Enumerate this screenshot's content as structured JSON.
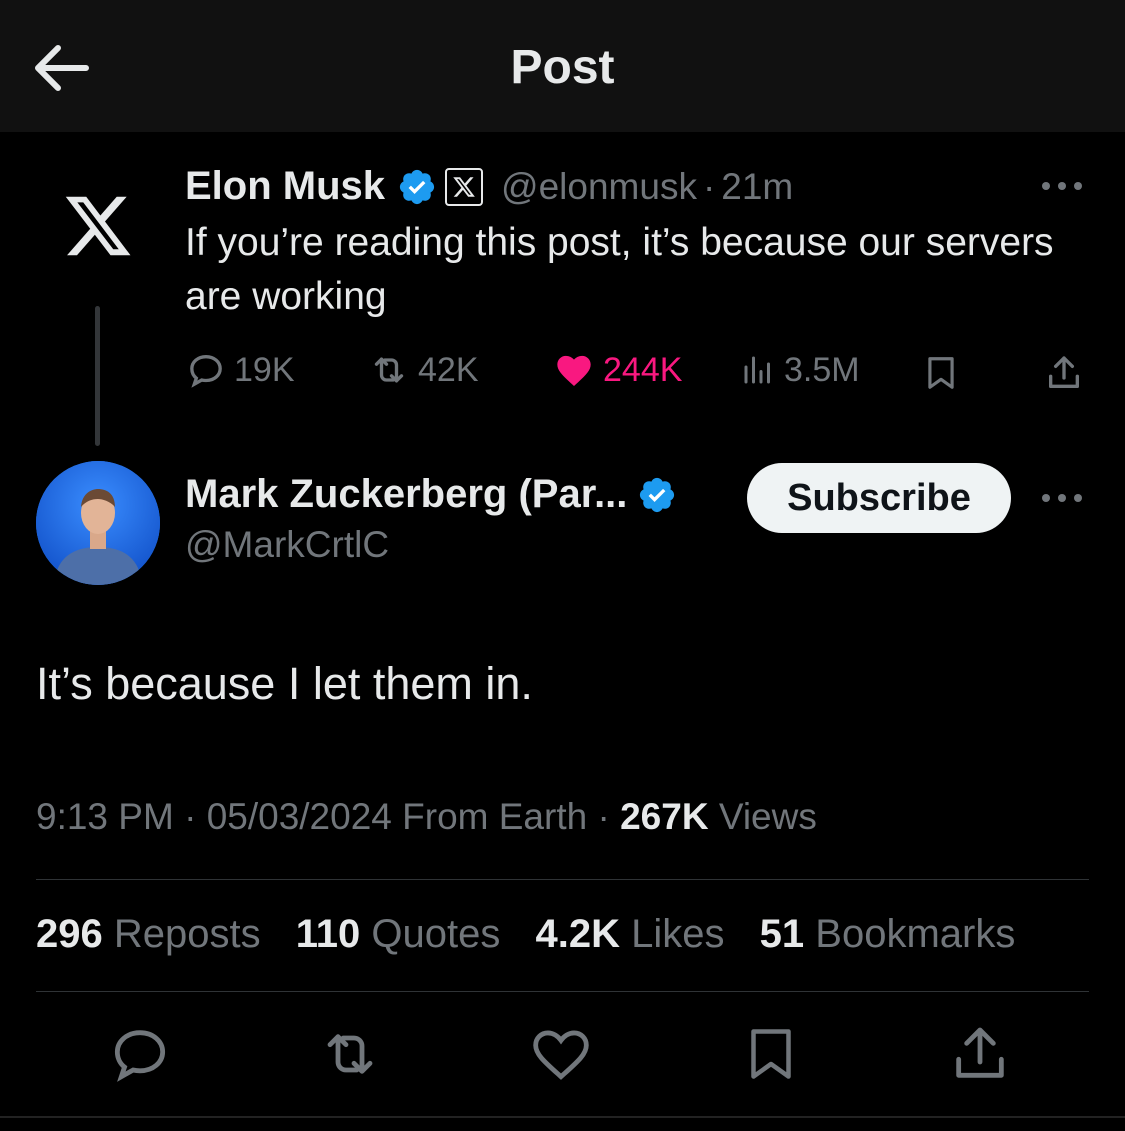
{
  "header": {
    "title": "Post",
    "back_icon": "arrow-left-icon"
  },
  "original_post": {
    "author_name": "Elon Musk",
    "verified_icon": "verified-badge-icon",
    "affiliate_icon": "x-affiliate-icon",
    "handle": "@elonmusk",
    "separator": "·",
    "time": "21m",
    "text": "If you’re reading this post, it’s because our servers are working",
    "replies": "19K",
    "reposts": "42K",
    "likes": "244K",
    "views": "3.5M",
    "like_color": "#f91880"
  },
  "reply_post": {
    "author_name": "Mark Zuckerberg (Par...",
    "verified_icon": "verified-badge-icon",
    "handle": "@MarkCrtlC",
    "subscribe_label": "Subscribe",
    "text": "It’s because I let them in.",
    "time": "9:13 PM",
    "date": "05/03/2024",
    "location": "From Earth",
    "sep": "·",
    "views_count": "267K",
    "views_label": "Views"
  },
  "stats": {
    "reposts_count": "296",
    "reposts_label": "Reposts",
    "quotes_count": "110",
    "quotes_label": "Quotes",
    "likes_count": "4.2K",
    "likes_label": "Likes",
    "bookmarks_count": "51",
    "bookmarks_label": "Bookmarks"
  },
  "colors": {
    "verified": "#1d9bf0",
    "muted": "#71767b",
    "text": "#e7e9ea"
  }
}
